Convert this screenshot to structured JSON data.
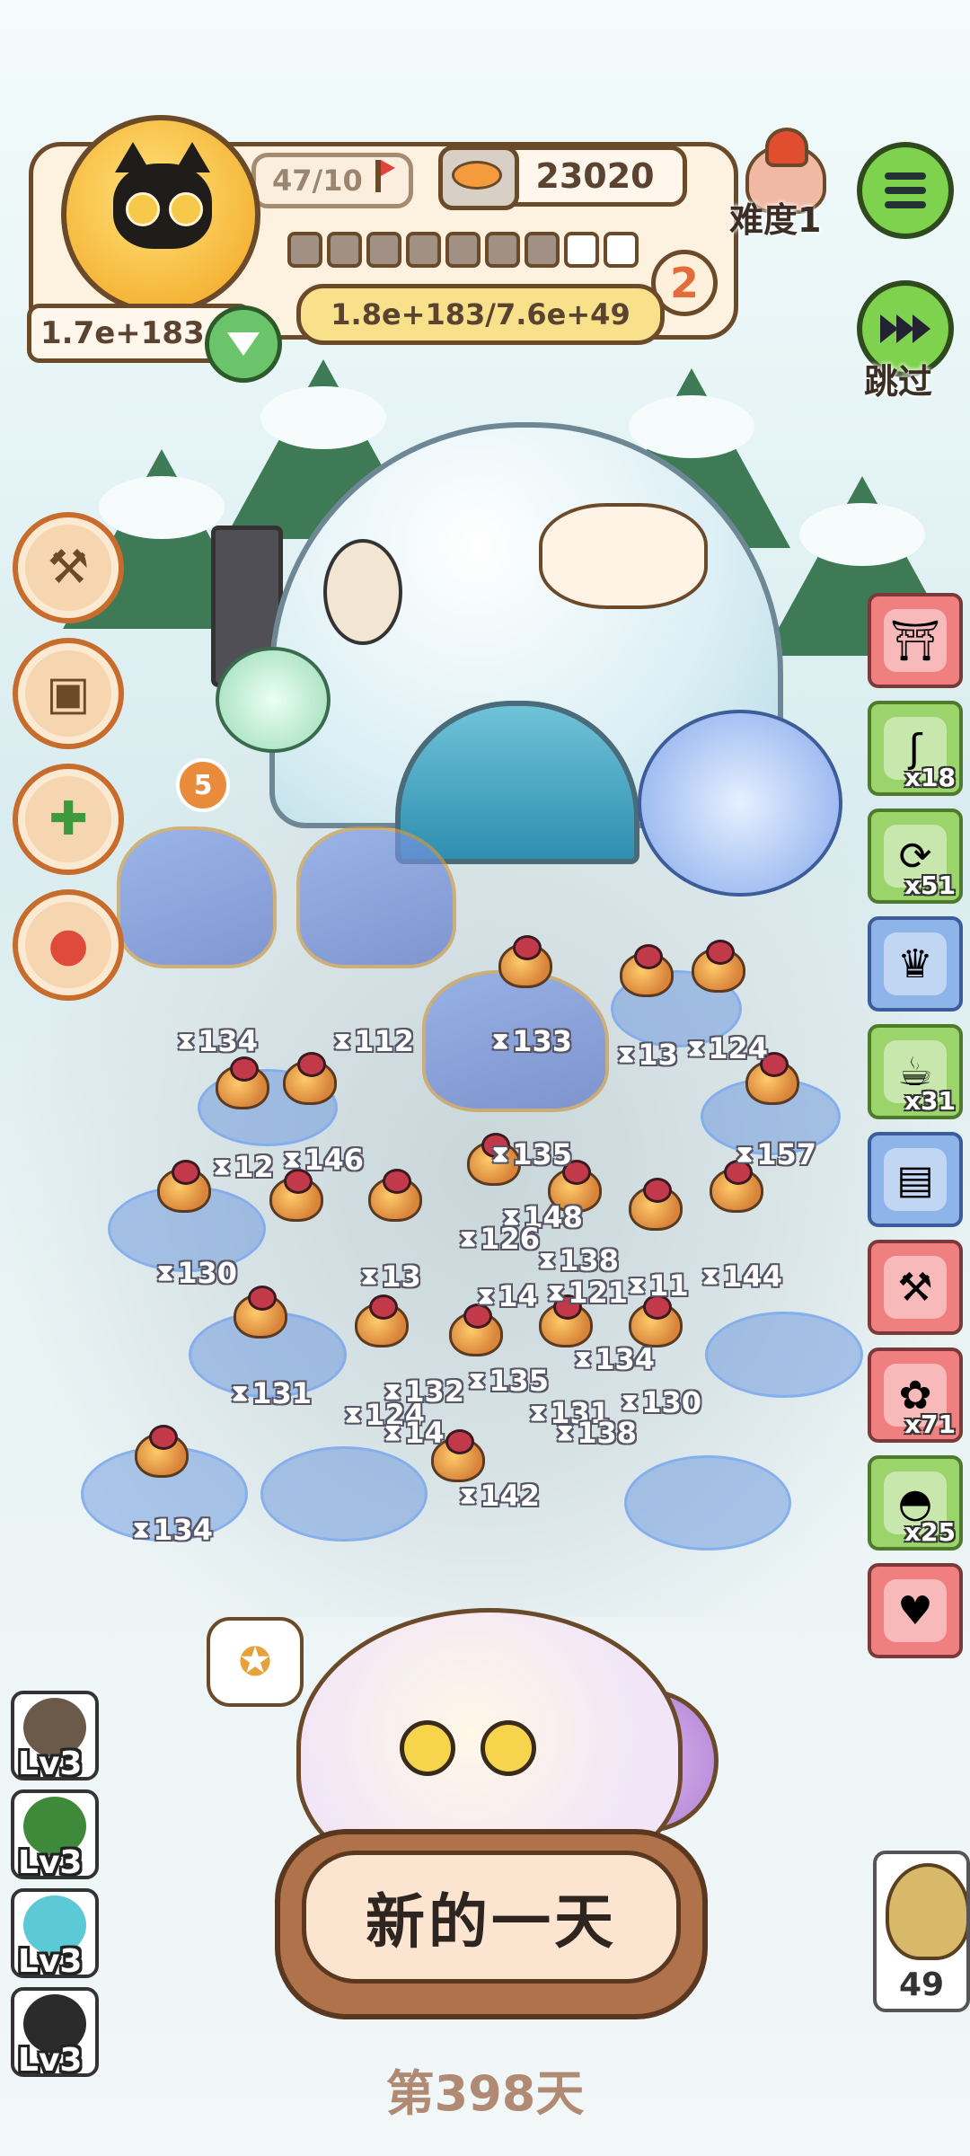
{
  "header": {
    "counter": "47/10",
    "coins": "23020",
    "difficulty_label": "难度1",
    "progress": {
      "filled": 7,
      "total": 9
    },
    "stage_number": "2",
    "hp_text": "1.8e+183/7.6e+49",
    "power_text": "1.7e+183"
  },
  "controls": {
    "skip_label": "跳过"
  },
  "summon_badge": "5",
  "battlefield_hp_labels": [
    "134",
    "112",
    "133",
    "13",
    "124",
    "12",
    "146",
    "135",
    "157",
    "148",
    "126",
    "138",
    "130",
    "13",
    "14",
    "121",
    "11",
    "144",
    "134",
    "131",
    "132",
    "135",
    "131",
    "130",
    "124",
    "14",
    "138",
    "142",
    "134"
  ],
  "right_items": [
    {
      "icon": "lantern-shrine-icon",
      "color": "red",
      "count": ""
    },
    {
      "icon": "worm-icon",
      "color": "green",
      "count": "x18"
    },
    {
      "icon": "scroll-ticket-icon",
      "color": "green",
      "count": "x51"
    },
    {
      "icon": "trophy-icon",
      "color": "blue",
      "count": ""
    },
    {
      "icon": "coffee-cup-icon",
      "color": "green",
      "count": "x31"
    },
    {
      "icon": "grinder-icon",
      "color": "blue",
      "count": ""
    },
    {
      "icon": "tools-rack-icon",
      "color": "red",
      "count": ""
    },
    {
      "icon": "gift-bag-icon",
      "color": "red",
      "count": "x71"
    },
    {
      "icon": "helmet-icon",
      "color": "green",
      "count": "x25"
    },
    {
      "icon": "pet-bowl-icon",
      "color": "red",
      "count": ""
    }
  ],
  "left_skills": [
    {
      "icon": "bat-broom-icon"
    },
    {
      "icon": "cardboard-box-icon"
    },
    {
      "icon": "medkit-icon"
    },
    {
      "icon": "joystick-icon"
    }
  ],
  "levels": [
    {
      "label": "Lv3",
      "color": "#6b5a4a"
    },
    {
      "label": "Lv3",
      "color": "#3f8a3a"
    },
    {
      "label": "Lv3",
      "color": "#5bc9d6"
    },
    {
      "label": "Lv3",
      "color": "#2b2b2b"
    }
  ],
  "new_day_button": "新的一天",
  "day_label": "第398天",
  "owl_count": "49",
  "colors": {
    "accent_green": "#7fd24d",
    "panel_brown": "#6b4a2a",
    "button_cream": "#fbe5d0"
  }
}
